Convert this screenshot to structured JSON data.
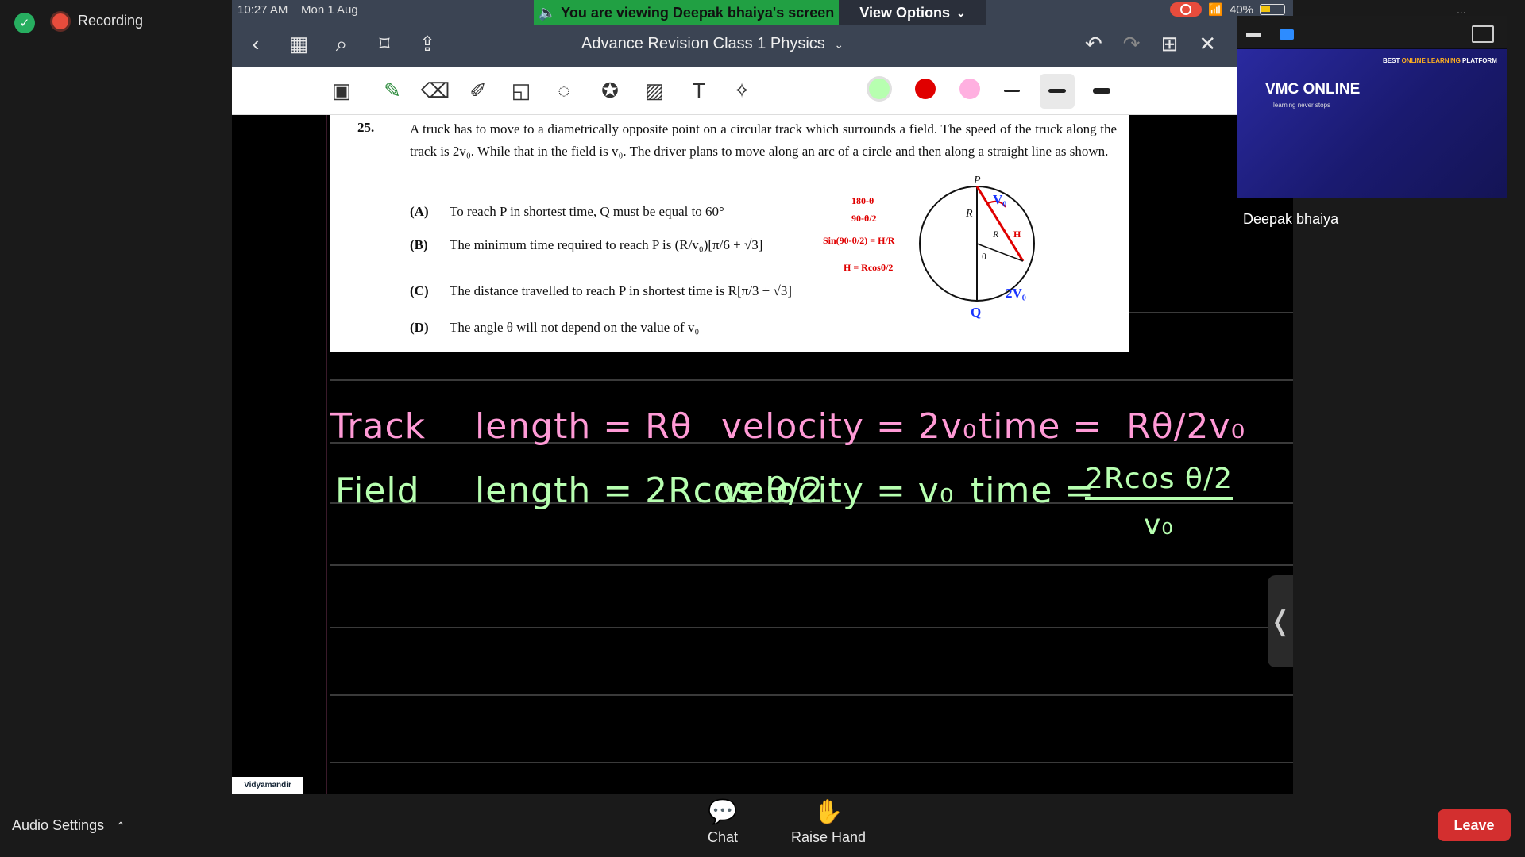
{
  "zoom": {
    "recording_label": "Recording",
    "audio_settings": "Audio Settings",
    "chat": "Chat",
    "raise_hand": "Raise Hand",
    "leave": "Leave",
    "participant_name": "Deepak bhaiya",
    "more": "..."
  },
  "share_banner": {
    "viewing_text": "You are viewing Deepak bhaiya's screen",
    "view_options": "View Options"
  },
  "ipad": {
    "time": "10:27 AM",
    "date": "Mon 1 Aug",
    "battery": "40%",
    "doc_title": "Advance Revision Class 1 Physics"
  },
  "question": {
    "number": "25.",
    "text": "A truck has to move to a diametrically opposite point on a circular track which surrounds a field. The speed of the truck along the track is 2v₀. While that in the field is v₀. The driver plans to move along an arc of a circle and then along a straight line as shown.",
    "options": [
      {
        "label": "(A)",
        "text": "To reach P in shortest time, Q must be equal to 60°"
      },
      {
        "label": "(B)",
        "text": "The minimum time required to reach P is (R/v₀)[π/6 + √3]"
      },
      {
        "label": "(C)",
        "text": "The distance travelled to reach P in shortest time is R[π/3 + √3]"
      },
      {
        "label": "(D)",
        "text": "The angle θ will not depend on the value of v₀"
      }
    ],
    "diagram": {
      "p_label": "P",
      "q_label": "Q",
      "r_label": "R",
      "r_label2": "R",
      "theta_label": "θ",
      "v0_label": "V₀",
      "h_label": "H",
      "two_v0_label": "2V₀",
      "notes": [
        "180-θ",
        "90-θ/2",
        "Sin(90-θ/2) = H/R",
        "H = Rcosθ/2"
      ]
    }
  },
  "handwriting": {
    "track_label": "Track",
    "track_length": "length = Rθ",
    "track_velocity": "velocity = 2v₀",
    "track_time": "time =  Rθ/2v₀",
    "field_label": "Field",
    "field_length": "length = 2Rcos θ/2",
    "field_velocity": "velocity = v₀",
    "field_time_num": "2Rcos θ/2",
    "field_time_label": "time =",
    "field_time_den": "v₀"
  },
  "video_tile": {
    "logo": "VMC ONLINE",
    "tagline": "learning never stops",
    "banner_prefix": "BEST ",
    "banner_highlight": "ONLINE LEARNING",
    "banner_suffix": " PLATFORM"
  },
  "badge": "Vidyamandir",
  "colors": {
    "pen_green": "#b7ffb0",
    "pen_red": "#e00000",
    "pen_pink": "#ff9ad6",
    "banner_green": "#21a043",
    "leave_red": "#d32f2f"
  }
}
